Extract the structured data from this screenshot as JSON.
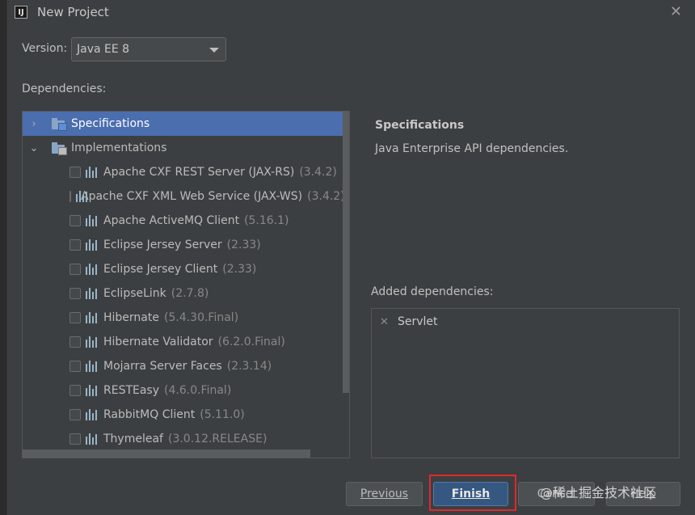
{
  "window": {
    "title": "New Project",
    "app_icon": "IJ",
    "close_icon": "close-icon"
  },
  "version": {
    "label": "Version:",
    "selected": "Java EE 8"
  },
  "dependencies_label": "Dependencies:",
  "tree": {
    "groups": [
      {
        "label": "Specifications",
        "expanded": false,
        "selected": true
      },
      {
        "label": "Implementations",
        "expanded": true,
        "selected": false
      }
    ],
    "items": [
      {
        "name": "Apache CXF REST Server (JAX-RS)",
        "version": "(3.4.2)",
        "checked": false
      },
      {
        "name": "Apache CXF XML Web Service (JAX-WS)",
        "version": "(3.4.2)",
        "checked": false
      },
      {
        "name": "Apache ActiveMQ Client",
        "version": "(5.16.1)",
        "checked": false
      },
      {
        "name": "Eclipse Jersey Server",
        "version": "(2.33)",
        "checked": false
      },
      {
        "name": "Eclipse Jersey Client",
        "version": "(2.33)",
        "checked": false
      },
      {
        "name": "EclipseLink",
        "version": "(2.7.8)",
        "checked": false
      },
      {
        "name": "Hibernate",
        "version": "(5.4.30.Final)",
        "checked": false
      },
      {
        "name": "Hibernate Validator",
        "version": "(6.2.0.Final)",
        "checked": false
      },
      {
        "name": "Mojarra Server Faces",
        "version": "(2.3.14)",
        "checked": false
      },
      {
        "name": "RESTEasy",
        "version": "(4.6.0.Final)",
        "checked": false
      },
      {
        "name": "RabbitMQ Client",
        "version": "(5.11.0)",
        "checked": false
      },
      {
        "name": "Thymeleaf",
        "version": "(3.0.12.RELEASE)",
        "checked": false
      }
    ]
  },
  "detail": {
    "title": "Specifications",
    "description": "Java Enterprise API dependencies."
  },
  "added": {
    "label": "Added dependencies:",
    "items": [
      "Servlet"
    ]
  },
  "buttons": {
    "previous": "Previous",
    "finish": "Finish",
    "cancel": "Cancel",
    "help": "Help"
  },
  "watermark": "@稀土掘金技术社区",
  "colors": {
    "selection": "#4b6eaf",
    "finish_button": "#365880",
    "highlight_box": "#e0282e",
    "background": "#3c3f41"
  }
}
